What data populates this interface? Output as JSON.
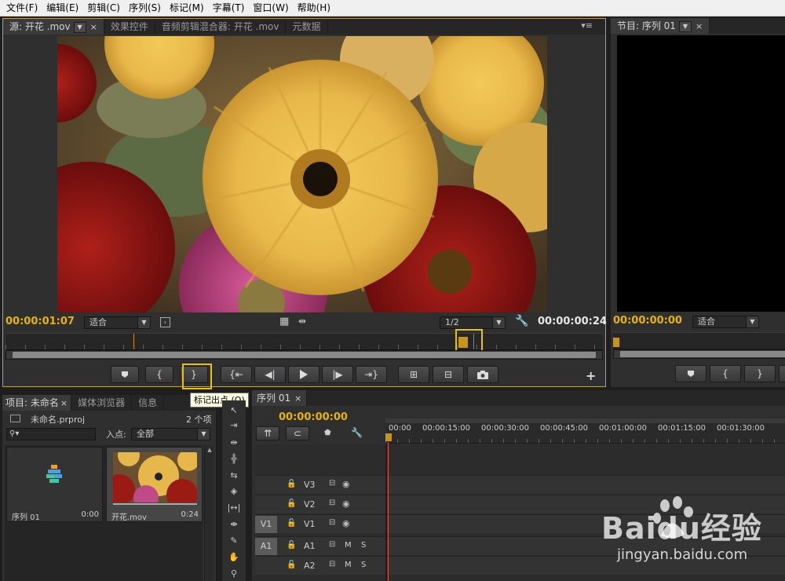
{
  "menu": [
    "文件(F)",
    "编辑(E)",
    "剪辑(C)",
    "序列(S)",
    "标记(M)",
    "字幕(T)",
    "窗口(W)",
    "帮助(H)"
  ],
  "source_panel": {
    "tabs": {
      "source": "源: 开花 .mov",
      "effect_controls": "效果控件",
      "audio_mixer": "音频剪辑混合器: 开花 .mov",
      "metadata": "元数据"
    },
    "timecode_in": "00:00:01:07",
    "fit": "适合",
    "resolution": "1/2",
    "duration": "00:00:00:24"
  },
  "program_panel": {
    "tab": "节目: 序列 01",
    "timecode": "00:00:00:00",
    "fit": "适合"
  },
  "tooltip": "标记出点 (O)",
  "project_panel": {
    "tabs": {
      "project": "项目: 未命名",
      "media_browser": "媒体浏览器",
      "info": "信息"
    },
    "project_file": "未命名.prproj",
    "item_count": "2 个项",
    "in_point_label": "入点:",
    "in_point_value": "全部",
    "items": [
      {
        "name": "序列 01",
        "duration": "0:00"
      },
      {
        "name": "开花.mov",
        "duration": "0:24"
      }
    ]
  },
  "timeline": {
    "tab": "序列 01",
    "timecode": "00:00:00:00",
    "ruler": [
      "00:00",
      "00:00:15:00",
      "00:00:30:00",
      "00:00:45:00",
      "00:01:00:00",
      "00:01:15:00",
      "00:01:30:00"
    ],
    "video_tracks": [
      "V3",
      "V2",
      "V1"
    ],
    "audio_tracks": [
      "A1",
      "A2"
    ],
    "source_patch_v": "V1",
    "source_patch_a": "A1",
    "mute_label": "M",
    "solo_label": "S"
  },
  "watermark": {
    "logo": "Baidu经验",
    "url": "jingyan.baidu.com"
  },
  "colors": {
    "timecode": "#e8b400",
    "playhead": "#e05a4a",
    "highlight": "#e3c21a"
  }
}
